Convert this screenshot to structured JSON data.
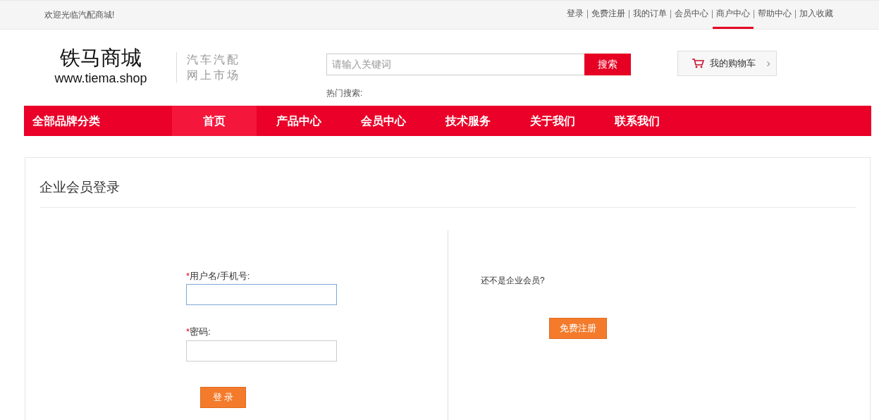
{
  "top_bar": {
    "welcome": "欢迎光临汽配商城!",
    "links": [
      {
        "label": "登录",
        "selected": false
      },
      {
        "label": "免费注册",
        "selected": false
      },
      {
        "label": "我的订单",
        "selected": false
      },
      {
        "label": "会员中心",
        "selected": false
      },
      {
        "label": "商户中心",
        "selected": true
      },
      {
        "label": "帮助中心",
        "selected": false
      },
      {
        "label": "加入收藏",
        "selected": false
      }
    ]
  },
  "header": {
    "logo_title": "铁马商城",
    "logo_url": "www.tiema.shop",
    "slogan": [
      "汽车汽配",
      "网上市场"
    ],
    "search": {
      "placeholder": "请输入关键词",
      "button": "搜索",
      "hot_label": "热门搜索:"
    },
    "cart": {
      "label": "我的购物车",
      "arrow": "›"
    }
  },
  "nav": {
    "category": "全部品牌分类",
    "items": [
      {
        "label": "首页",
        "selected": true
      },
      {
        "label": "产品中心",
        "selected": false
      },
      {
        "label": "会员中心",
        "selected": false
      },
      {
        "label": "技术服务",
        "selected": false
      },
      {
        "label": "关于我们",
        "selected": false
      },
      {
        "label": "联系我们",
        "selected": false
      }
    ]
  },
  "login": {
    "title": "企业会员登录",
    "fields": [
      {
        "required_mark": "*",
        "label": "用户名/手机号:",
        "focused": true
      },
      {
        "required_mark": "*",
        "label": "密码:",
        "focused": false
      }
    ],
    "submit": "登 录",
    "register_prompt": "还不是企业会员?",
    "register_button": "免费注册"
  }
}
